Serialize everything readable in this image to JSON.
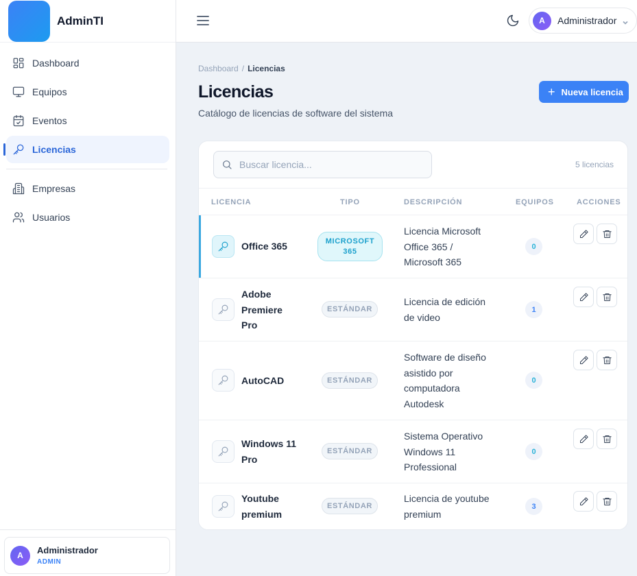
{
  "app": {
    "name": "AdminTI"
  },
  "sidebar": {
    "items": [
      {
        "label": "Dashboard",
        "icon": "dashboard-icon"
      },
      {
        "label": "Equipos",
        "icon": "monitor-icon"
      },
      {
        "label": "Eventos",
        "icon": "calendar-icon"
      },
      {
        "label": "Licencias",
        "icon": "key-icon",
        "active": true
      },
      {
        "label": "Empresas",
        "icon": "building-icon"
      },
      {
        "label": "Usuarios",
        "icon": "users-icon"
      }
    ],
    "user": {
      "initial": "A",
      "name": "Administrador",
      "role": "ADMIN"
    }
  },
  "topbar": {
    "user": {
      "initial": "A",
      "name": "Administrador"
    }
  },
  "breadcrumb": {
    "parent": "Dashboard",
    "separator": "/",
    "current": "Licencias"
  },
  "page": {
    "title": "Licencias",
    "subtitle": "Catálogo de licencias de software del sistema",
    "new_button": "Nueva licencia"
  },
  "search": {
    "placeholder": "Buscar licencia..."
  },
  "count_label": "5 licencias",
  "table": {
    "columns": [
      "LICENCIA",
      "TIPO",
      "DESCRIPCIÓN",
      "EQUIPOS",
      "ACCIONES"
    ],
    "rows": [
      {
        "name": "Office 365",
        "type": "MICROSOFT 365",
        "description": "Licencia Microsoft Office 365 / Microsoft 365",
        "equipos": "0"
      },
      {
        "name": "Adobe Premiere Pro",
        "type": "ESTÁNDAR",
        "description": "Licencia de edición de video",
        "equipos": "1"
      },
      {
        "name": "AutoCAD",
        "type": "ESTÁNDAR",
        "description": "Software de diseño asistido por computadora Autodesk",
        "equipos": "0"
      },
      {
        "name": "Windows 11 Pro",
        "type": "ESTÁNDAR",
        "description": "Sistema Operativo Windows 11 Professional",
        "equipos": "0"
      },
      {
        "name": "Youtube premium",
        "type": "ESTÁNDAR",
        "description": "Licencia de youtube premium",
        "equipos": "3"
      }
    ]
  },
  "colors": {
    "accent": "#3b82f6",
    "active_nav": "#2b66d8",
    "microsoft_badge": "#1ba0cc",
    "background": "#eef2f7"
  }
}
